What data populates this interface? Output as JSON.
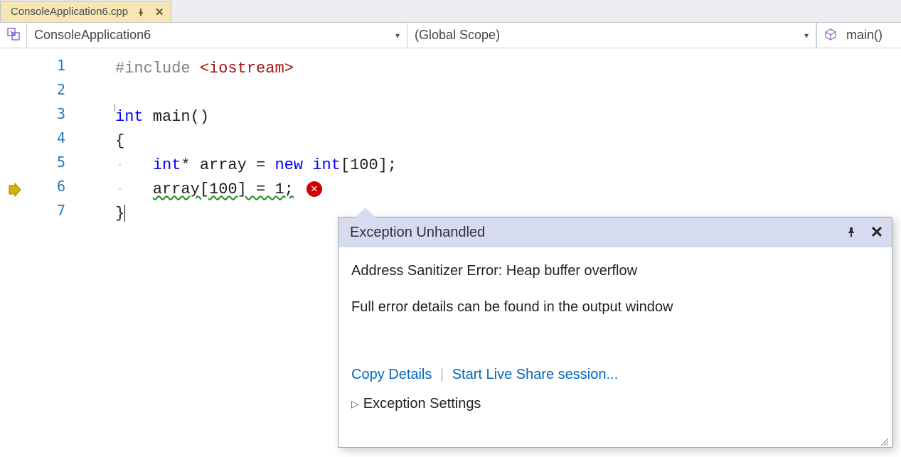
{
  "tab": {
    "filename": "ConsoleApplication6.cpp",
    "pinned": true
  },
  "nav": {
    "project": "ConsoleApplication6",
    "scope": "(Global Scope)",
    "function": "main()"
  },
  "code": {
    "lines": [
      {
        "n": 1
      },
      {
        "n": 2
      },
      {
        "n": 3
      },
      {
        "n": 4
      },
      {
        "n": 5
      },
      {
        "n": 6
      },
      {
        "n": 7
      }
    ],
    "tokens": {
      "include": "#include ",
      "iostream": "<iostream>",
      "int_kw": "int",
      "main_ident": " main()",
      "brace_open": "{",
      "star": "*",
      "array_ident": " array ",
      "eq": "= ",
      "new_kw": "new ",
      "bracket100": "[100]",
      "semi": ";",
      "array_sub_expr": "array[100] = 1;",
      "brace_close": "}"
    },
    "num100": "100",
    "num1": "1"
  },
  "popup": {
    "title": "Exception Unhandled",
    "msg1": "Address Sanitizer Error: Heap buffer overflow",
    "msg2": "Full error details can be found in the output window",
    "copy": "Copy Details",
    "liveshare": "Start Live Share session...",
    "exsettings": "Exception Settings"
  }
}
